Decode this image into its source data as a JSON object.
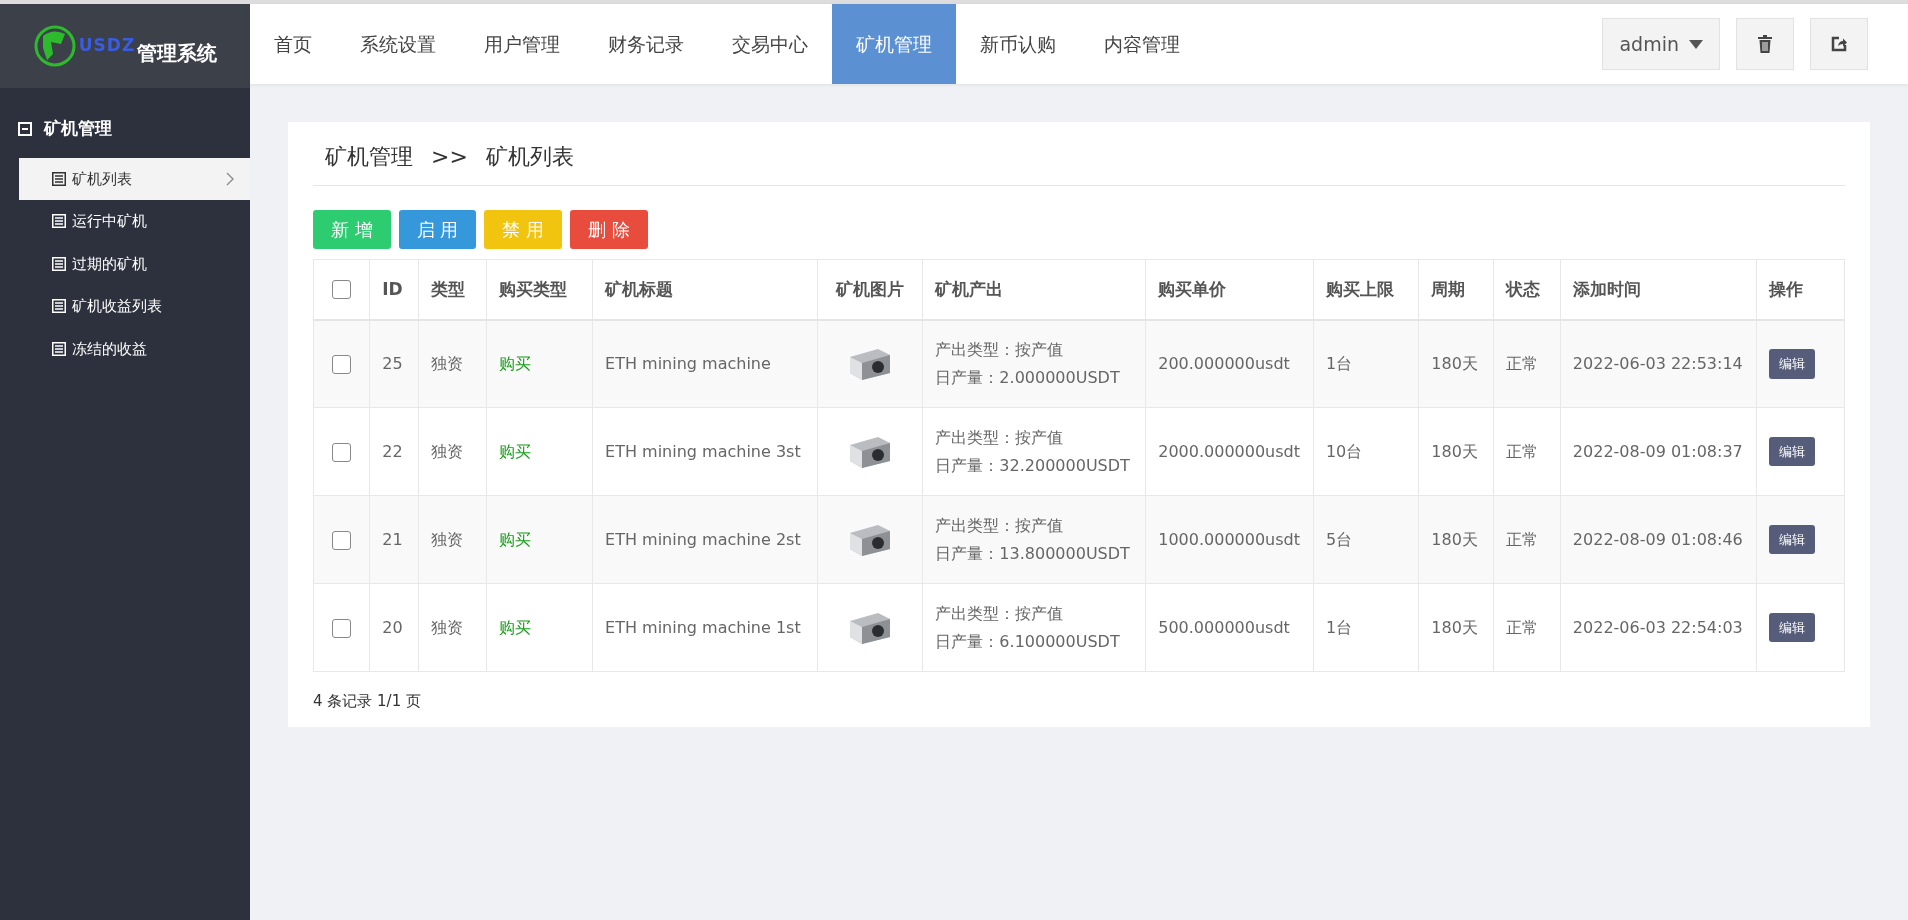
{
  "logo": {
    "mark": "USDZ",
    "title": "管理系统"
  },
  "nav": [
    {
      "label": "首页",
      "selected": false
    },
    {
      "label": "系统设置",
      "selected": false
    },
    {
      "label": "用户管理",
      "selected": false
    },
    {
      "label": "财务记录",
      "selected": false
    },
    {
      "label": "交易中心",
      "selected": false
    },
    {
      "label": "矿机管理",
      "selected": true
    },
    {
      "label": "新币认购",
      "selected": false
    },
    {
      "label": "内容管理",
      "selected": false
    }
  ],
  "user_menu": {
    "label": "admin"
  },
  "sidebar": {
    "title": "矿机管理",
    "items": [
      {
        "label": "矿机列表",
        "selected": true
      },
      {
        "label": "运行中矿机",
        "selected": false
      },
      {
        "label": "过期的矿机",
        "selected": false
      },
      {
        "label": "矿机收益列表",
        "selected": false
      },
      {
        "label": "冻结的收益",
        "selected": false
      }
    ]
  },
  "breadcrumb": [
    "矿机管理",
    ">>",
    "矿机列表"
  ],
  "actions": [
    {
      "label": "新 增",
      "kind": "add"
    },
    {
      "label": "启 用",
      "kind": "enable"
    },
    {
      "label": "禁 用",
      "kind": "disable"
    },
    {
      "label": "删 除",
      "kind": "delete"
    }
  ],
  "table": {
    "select_all": {
      "checked": false
    },
    "columns": [
      "ID",
      "类型",
      "购买类型",
      "矿机标题",
      "矿机图片",
      "矿机产出",
      "购买单价",
      "购买上限",
      "周期",
      "状态",
      "添加时间",
      "操作"
    ],
    "rows": [
      {
        "checked": false,
        "id": "25",
        "type": "独资",
        "buy_type": "购买",
        "title": "ETH mining machine",
        "output_type": "产出类型：按产值",
        "daily_output": "日产量：2.000000USDT",
        "price": "200.000000usdt",
        "limit": "1台",
        "period": "180天",
        "status": "正常",
        "added": "2022-06-03 22:53:14",
        "action": "编辑"
      },
      {
        "checked": false,
        "id": "22",
        "type": "独资",
        "buy_type": "购买",
        "title": "ETH mining machine 3st",
        "output_type": "产出类型：按产值",
        "daily_output": "日产量：32.200000USDT",
        "price": "2000.000000usdt",
        "limit": "10台",
        "period": "180天",
        "status": "正常",
        "added": "2022-08-09 01:08:37",
        "action": "编辑"
      },
      {
        "checked": false,
        "id": "21",
        "type": "独资",
        "buy_type": "购买",
        "title": "ETH mining machine 2st",
        "output_type": "产出类型：按产值",
        "daily_output": "日产量：13.800000USDT",
        "price": "1000.000000usdt",
        "limit": "5台",
        "period": "180天",
        "status": "正常",
        "added": "2022-08-09 01:08:46",
        "action": "编辑"
      },
      {
        "checked": false,
        "id": "20",
        "type": "独资",
        "buy_type": "购买",
        "title": "ETH mining machine 1st",
        "output_type": "产出类型：按产值",
        "daily_output": "日产量：6.100000USDT",
        "price": "500.000000usdt",
        "limit": "1台",
        "period": "180天",
        "status": "正常",
        "added": "2022-06-03 22:54:03",
        "action": "编辑"
      }
    ]
  },
  "pagination": "4 条记录 1/1 页"
}
